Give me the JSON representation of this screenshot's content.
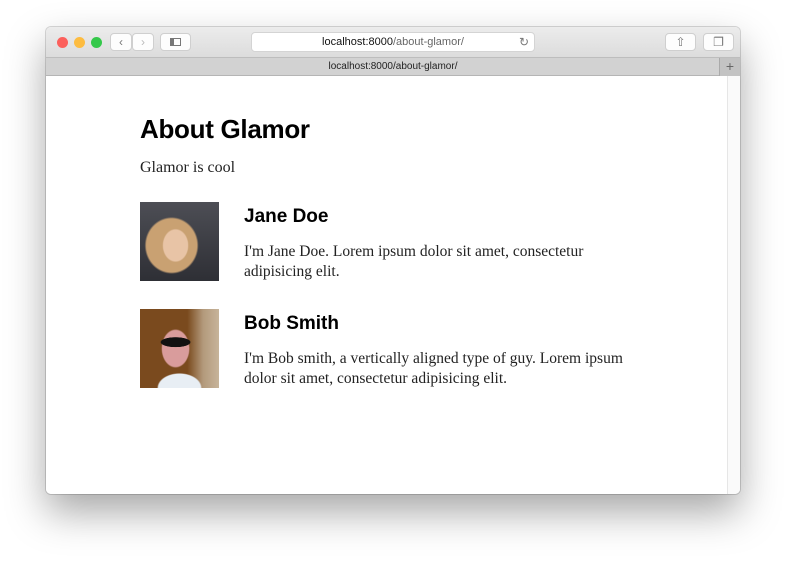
{
  "browser": {
    "url_host": "localhost:8000",
    "url_path": "/about-glamor/",
    "tab_title": "localhost:8000/about-glamor/",
    "colors": {
      "close": "#fc605c",
      "minimize": "#fdbc40",
      "zoom": "#34c84a"
    }
  },
  "page": {
    "title": "About Glamor",
    "intro": "Glamor is cool",
    "people": [
      {
        "name": "Jane Doe",
        "bio": "I'm Jane Doe. Lorem ipsum dolor sit amet, consectetur adipisicing elit."
      },
      {
        "name": "Bob Smith",
        "bio": "I'm Bob smith, a vertically aligned type of guy. Lorem ipsum dolor sit amet, consectetur adipisicing elit."
      }
    ]
  }
}
